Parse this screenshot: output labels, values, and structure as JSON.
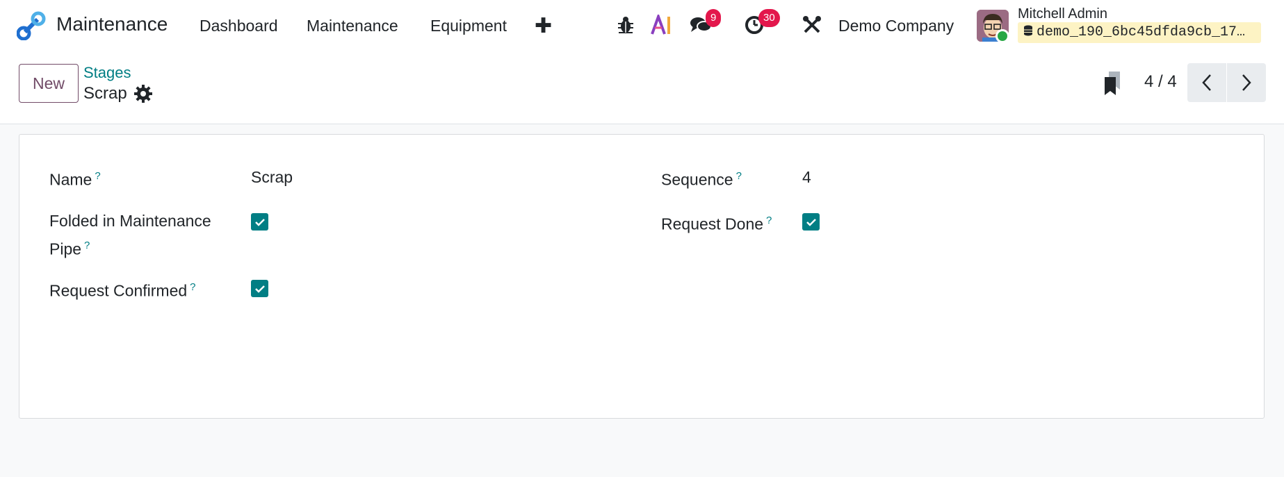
{
  "navbar": {
    "app_name": "Maintenance",
    "menu": [
      "Dashboard",
      "Maintenance",
      "Equipment"
    ],
    "plus_label": "✚",
    "messages_count": "9",
    "activities_count": "30",
    "company": "Demo Company",
    "user_name": "Mitchell Admin",
    "database": "demo_190_6bc45dfda9cb_17…"
  },
  "control": {
    "new_label": "New",
    "breadcrumb_parent": "Stages",
    "breadcrumb_current": "Scrap",
    "pager": "4 / 4"
  },
  "form": {
    "name_label": "Name",
    "name_value": "Scrap",
    "folded_label_line1": "Folded in Maintenance",
    "folded_label_line2": "Pipe",
    "folded_checked": true,
    "confirmed_label": "Request Confirmed",
    "confirmed_checked": true,
    "sequence_label": "Sequence",
    "sequence_value": "4",
    "done_label": "Request Done",
    "done_checked": true,
    "help_mark": "?"
  },
  "colors": {
    "brand": "#714b67",
    "link": "#017e84",
    "badge": "#e3174c"
  }
}
